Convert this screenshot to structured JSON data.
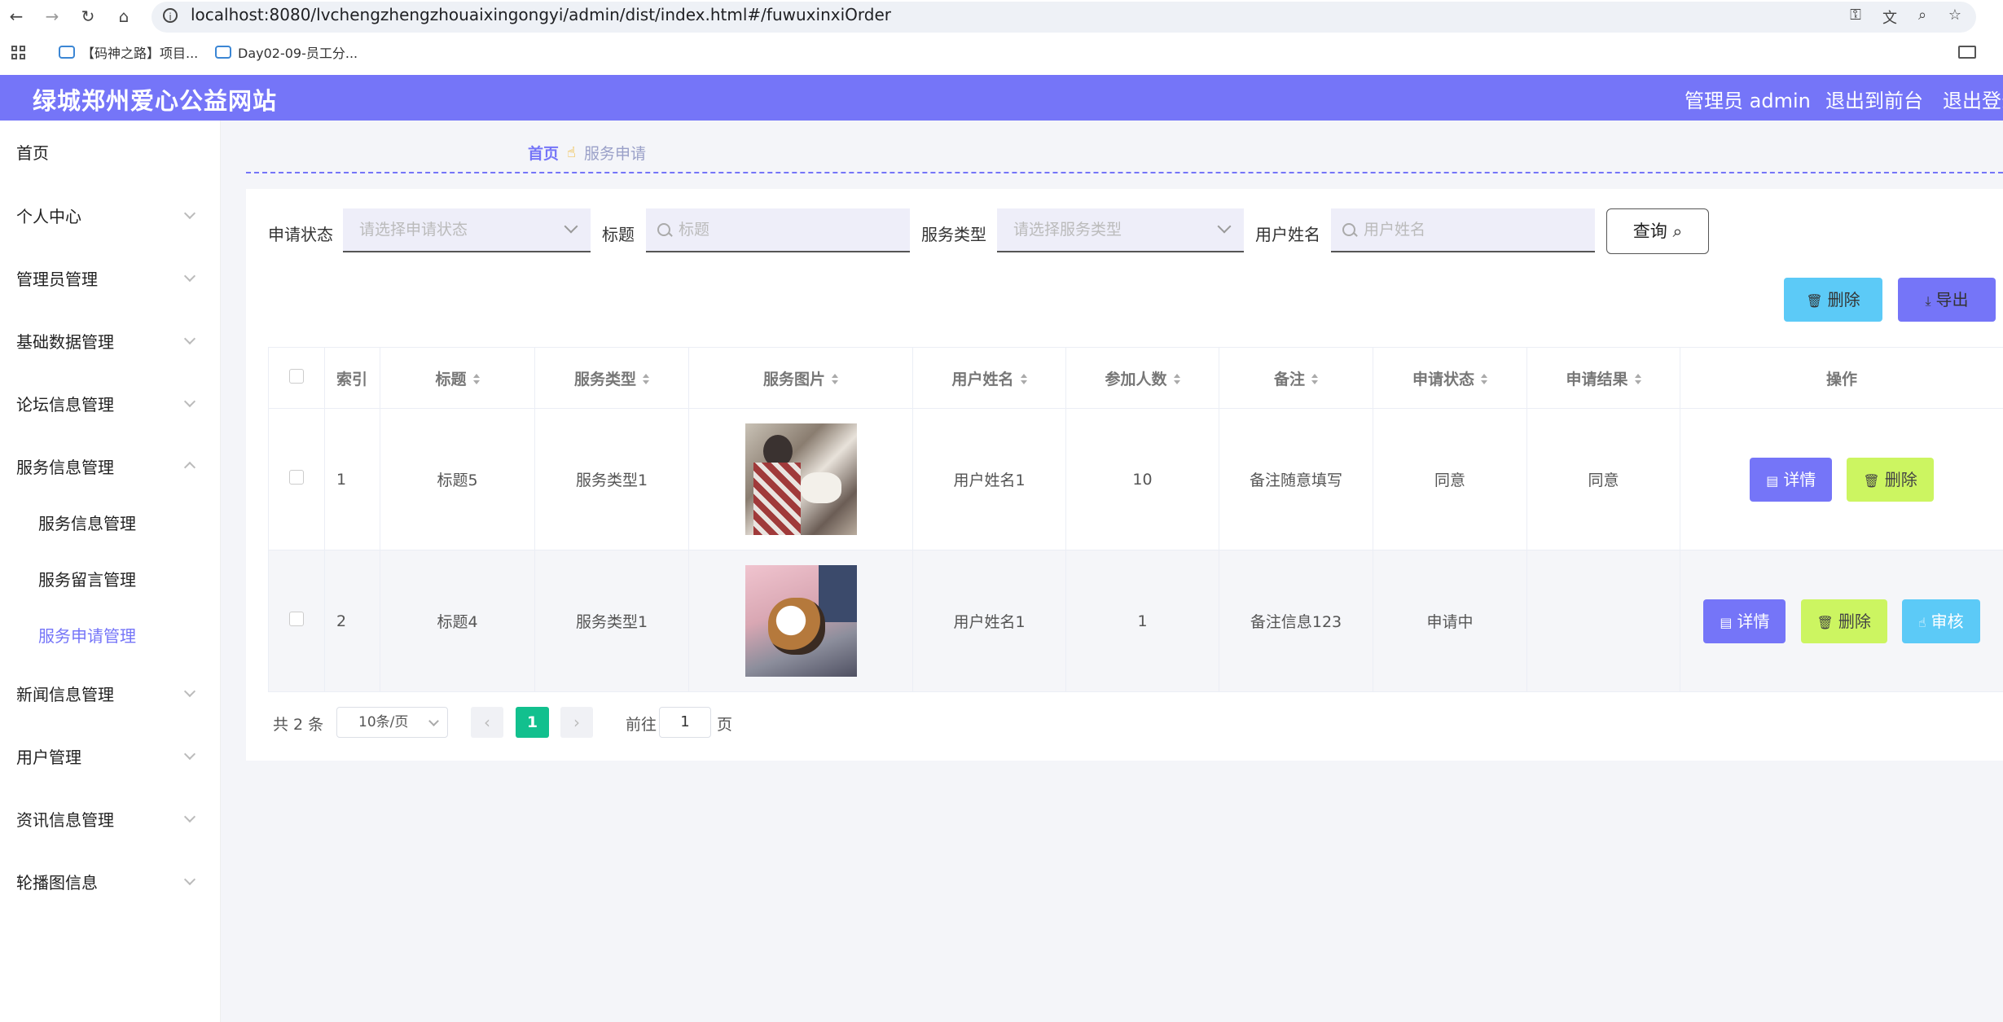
{
  "browser": {
    "url": "localhost:8080/lvchengzhengzhouaixingongyi/admin/dist/index.html#/fuwuxinxiOrder",
    "bookmarks": [
      "【码神之路】项目...",
      "Day02-09-员工分..."
    ]
  },
  "header": {
    "site_title": "绿城郑州爱心公益网站",
    "admin_label": "管理员 admin",
    "exit_front": "退出到前台",
    "logout": "退出登录"
  },
  "sidebar": {
    "items": [
      {
        "label": "首页"
      },
      {
        "label": "个人中心"
      },
      {
        "label": "管理员管理"
      },
      {
        "label": "基础数据管理"
      },
      {
        "label": "论坛信息管理"
      },
      {
        "label": "服务信息管理"
      },
      {
        "label": "服务信息管理"
      },
      {
        "label": "服务留言管理"
      },
      {
        "label": "服务申请管理"
      },
      {
        "label": "新闻信息管理"
      },
      {
        "label": "用户管理"
      },
      {
        "label": "资讯信息管理"
      },
      {
        "label": "轮播图信息"
      }
    ]
  },
  "breadcrumb": {
    "home": "首页",
    "current": "服务申请"
  },
  "filters": {
    "status_label": "申请状态",
    "status_placeholder": "请选择申请状态",
    "title_label": "标题",
    "title_placeholder": "标题",
    "type_label": "服务类型",
    "type_placeholder": "请选择服务类型",
    "user_label": "用户姓名",
    "user_placeholder": "用户姓名",
    "query_button": "查询"
  },
  "toolbar": {
    "delete_label": "删除",
    "export_label": "导出"
  },
  "table": {
    "columns": [
      "索引",
      "标题",
      "服务类型",
      "服务图片",
      "用户姓名",
      "参加人数",
      "备注",
      "申请状态",
      "申请结果",
      "操作"
    ],
    "rows": [
      {
        "index": "1",
        "title": "标题5",
        "type": "服务类型1",
        "user": "用户姓名1",
        "count": "10",
        "note": "备注随意填写",
        "status": "同意",
        "result": "同意"
      },
      {
        "index": "2",
        "title": "标题4",
        "type": "服务类型1",
        "user": "用户姓名1",
        "count": "1",
        "note": "备注信息123",
        "status": "申请中",
        "result": ""
      }
    ],
    "actions": {
      "detail": "详情",
      "delete": "删除",
      "audit": "审核"
    }
  },
  "pagination": {
    "total": "共 2 条",
    "page_size": "10条/页",
    "current_page": "1",
    "goto_label": "前往",
    "goto_value": "1",
    "goto_unit": "页"
  },
  "colors": {
    "accent": "#7575f8",
    "info": "#5ccaf7",
    "warning": "#ccf561",
    "page_active": "#12c08e"
  }
}
